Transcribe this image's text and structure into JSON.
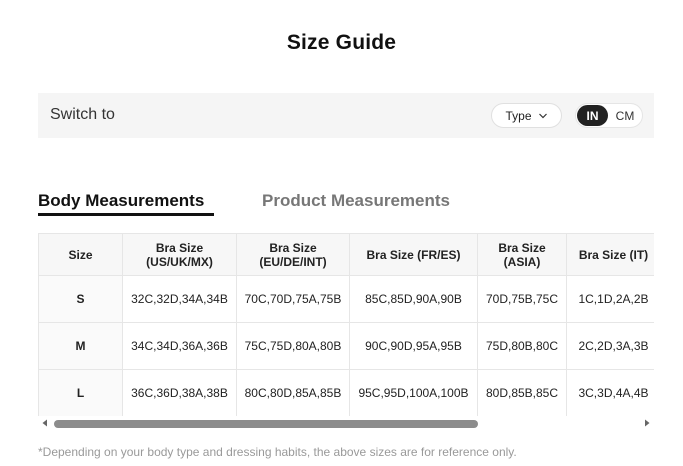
{
  "page": {
    "title": "Size Guide"
  },
  "switch_bar": {
    "label": "Switch to",
    "type_button": "Type",
    "units": {
      "in": "IN",
      "cm": "CM",
      "selected": "IN"
    }
  },
  "tabs": [
    {
      "label": "Body Measurements",
      "active": true
    },
    {
      "label": "Product Measurements",
      "active": false
    }
  ],
  "table": {
    "headers": [
      {
        "line1": "Size",
        "line2": ""
      },
      {
        "line1": "Bra Size",
        "line2": "(US/UK/MX)"
      },
      {
        "line1": "Bra Size",
        "line2": "(EU/DE/INT)"
      },
      {
        "line1": "Bra Size (FR/ES)",
        "line2": ""
      },
      {
        "line1": "Bra Size",
        "line2": "(ASIA)"
      },
      {
        "line1": "Bra Size (IT)",
        "line2": ""
      }
    ],
    "rows": [
      [
        "S",
        "32C,32D,34A,34B",
        "70C,70D,75A,75B",
        "85C,85D,90A,90B",
        "70D,75B,75C",
        "1C,1D,2A,2B"
      ],
      [
        "M",
        "34C,34D,36A,36B",
        "75C,75D,80A,80B",
        "90C,90D,95A,95B",
        "75D,80B,80C",
        "2C,2D,3A,3B"
      ],
      [
        "L",
        "36C,36D,38A,38B",
        "80C,80D,85A,85B",
        "95C,95D,100A,100B",
        "80D,85B,85C",
        "3C,3D,4A,4B"
      ]
    ]
  },
  "footnote": "*Depending on your body type and dressing habits, the above sizes are for reference only.",
  "icons": {
    "type_dropdown": "chevron-down-icon",
    "scroll_left": "triangle-left-icon",
    "scroll_right": "triangle-right-icon"
  }
}
